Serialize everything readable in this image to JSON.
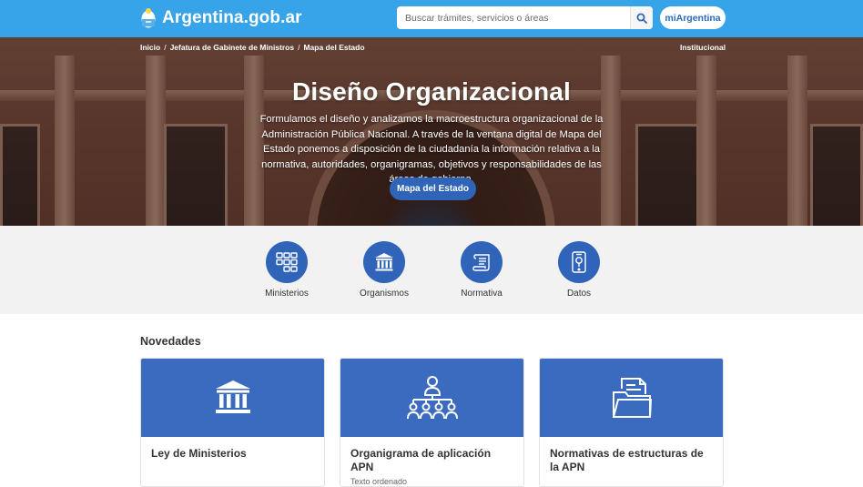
{
  "header": {
    "brand": "Argentina.gob.ar",
    "search_placeholder": "Buscar trámites, servicios o áreas",
    "account_label": "miArgentina"
  },
  "breadcrumb": {
    "items": [
      "Inicio",
      "Jefatura de Gabinete de Ministros",
      "Mapa del Estado"
    ],
    "right_link": "Institucional"
  },
  "hero": {
    "title": "Diseño Organizacional",
    "description": "Formulamos el diseño y analizamos la macroestructura organizacional de la Administración Pública Nacional. A través de la ventana digital de Mapa del Estado ponemos a disposición de la ciudadanía la información relativa a la normativa, autoridades, organigramas, objetivos y responsabilidades de las áreas de gobierno.",
    "button": "Mapa del Estado"
  },
  "quick_access": [
    {
      "label": "Ministerios",
      "icon": "grid-icon"
    },
    {
      "label": "Organismos",
      "icon": "institution-icon"
    },
    {
      "label": "Normativa",
      "icon": "scroll-icon"
    },
    {
      "label": "Datos",
      "icon": "phone-data-icon"
    }
  ],
  "novedades": {
    "title": "Novedades",
    "cards": [
      {
        "title": "Ley de Ministerios",
        "subtitle": "",
        "icon": "institution-icon"
      },
      {
        "title": "Organigrama de aplicación APN",
        "subtitle": "Texto ordenado",
        "icon": "org-chart-icon"
      },
      {
        "title": "Normativas de estructuras de la APN",
        "subtitle": "",
        "icon": "folder-documents-icon"
      }
    ]
  },
  "colors": {
    "topbar": "#37a3e8",
    "primary": "#2f64b8",
    "card_header": "#3b6bbf"
  }
}
